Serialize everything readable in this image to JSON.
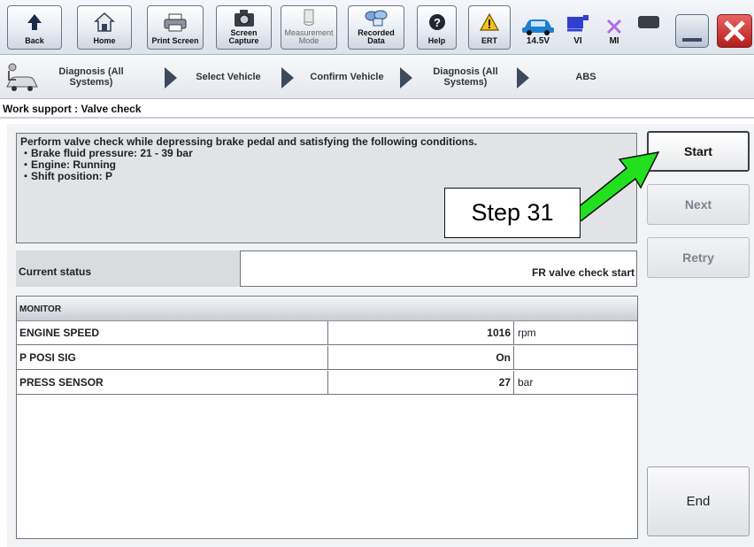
{
  "toolbar": {
    "back": "Back",
    "home": "Home",
    "print_screen": "Print Screen",
    "screen_capture": "Screen Capture",
    "measurement_mode": "Measurement Mode",
    "recorded_data": "Recorded Data",
    "help": "Help",
    "ert": "ERT",
    "battery_voltage": "14.5V",
    "vi": "VI",
    "mi": "MI"
  },
  "breadcrumb": {
    "items": [
      "Diagnosis (All Systems)",
      "Select Vehicle",
      "Confirm Vehicle",
      "Diagnosis (All Systems)",
      "ABS"
    ]
  },
  "page": {
    "title": "Work support : Valve check"
  },
  "instructions": {
    "lines": [
      "Perform valve check while depressing brake pedal and satisfying the following conditions.",
      "・Brake fluid pressure: 21 - 39 bar",
      "・Engine: Running",
      "・Shift position: P"
    ]
  },
  "status": {
    "label": "Current status",
    "value": "FR valve check start"
  },
  "monitor": {
    "header": "MONITOR",
    "rows": [
      {
        "name": "ENGINE SPEED",
        "value": "1016",
        "unit": "rpm"
      },
      {
        "name": "P POSI SIG",
        "value": "On",
        "unit": ""
      },
      {
        "name": "PRESS SENSOR",
        "value": "27",
        "unit": "bar"
      }
    ]
  },
  "buttons": {
    "start": "Start",
    "next": "Next",
    "retry": "Retry",
    "end": "End"
  },
  "annotation": {
    "text": "Step 31",
    "arrow_color": "#22e01f"
  },
  "colors": {
    "close": "#d9292a",
    "ert_warning": "#f2c21b",
    "mi_cross": "#b36be0",
    "vi_icon": "#2f3fd0",
    "car_icon": "#1c7fd6"
  }
}
